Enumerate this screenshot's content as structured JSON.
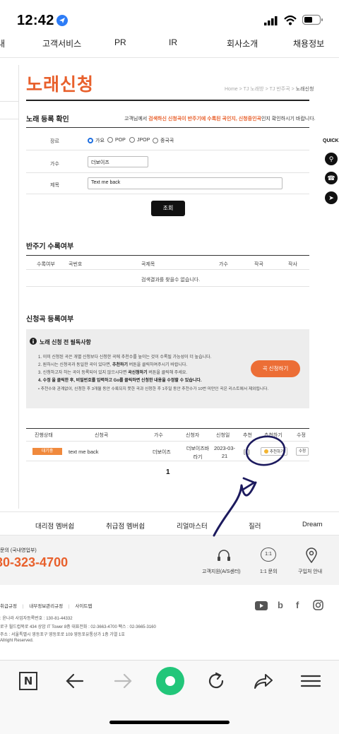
{
  "status_bar": {
    "time": "12:42"
  },
  "nav": {
    "items": [
      "내",
      "고객서비스",
      "PR",
      "IR",
      "회사소개",
      "채용정보"
    ]
  },
  "page": {
    "title": "노래신청",
    "breadcrumb": [
      "Home",
      ">",
      "TJ 노래방",
      ">",
      "TJ 반주곡",
      ">"
    ],
    "breadcrumb_current": "노래신청"
  },
  "register": {
    "heading": "노래 등록 확인",
    "notice_prefix": "고객님께서 ",
    "notice_highlight": "검색하신 신청곡이 반주기에 수록된 곡인지, 신청중인곡",
    "notice_suffix": "인지 확인하시기 바랍니다.",
    "genre_label": "장르",
    "genre_options": [
      "가요",
      "POP",
      "JPOP",
      "중국곡"
    ],
    "genre_selected": "가요",
    "singer_label": "가수",
    "singer_value": "더보이즈",
    "title_label": "제목",
    "title_value": "Text me back",
    "search_button": "조회"
  },
  "accompaniment": {
    "heading": "반주기 수록여부",
    "columns": [
      "수록여부",
      "곡번호",
      "곡제목",
      "가수",
      "작곡",
      "작사"
    ],
    "empty_message": "검색결과를 찾을수 없습니다."
  },
  "applied": {
    "heading": "신청곡 등록여부",
    "guide_title": "노래 신청 전 필독사항",
    "guide_lines": [
      "1. 이미 신청된 곡은 개별 신청보다 신청한 곡에 추천수를 높이는 것이 수록될 가능성이 더 높습니다.",
      "2. 원하시는 신청곡과 동일한 곡이 있다면, ",
      "3. 신청하고자 하는 곡이 등록되어 있지 않으시다면 ",
      "4. 수정 을 클릭한 후, 비밀번호를 입력하고 Go를 클릭하면 신청한 내용을 수정할 수 있습니다.",
      "• 추천수와 관계없이, 신청한 후 3개월 동안 수록되지 못한 곡과 신청한 후 1주일 동안 추천수가 10번 미만인 곡은 리스트에서 제외됩니다."
    ],
    "guide_bold_1": "추천하기",
    "guide_tail_1": " 버튼을 클릭하여주시기 바랍니다.",
    "guide_bold_2": "곡신청하기",
    "guide_tail_2": " 버튼을 클릭해 주세요.",
    "apply_button": "곡 신청하기",
    "columns": [
      "진행상태",
      "신청곡",
      "가수",
      "신청자",
      "신청일",
      "추천",
      "추천하기",
      "수정"
    ],
    "rows": [
      {
        "status": "대기중",
        "song": "text me back",
        "singer": "더보이즈",
        "applicant_line1": "더보이즈바",
        "applicant_line2": "라기",
        "date_line1": "2023-03-",
        "date_line2": "21",
        "recommend_count": "[1]",
        "recommend_button": "추천하기",
        "edit_button": "수정"
      }
    ],
    "pagination": "1"
  },
  "quick": {
    "label": "QUICK"
  },
  "membership": {
    "items": [
      "대리점 멤버쉽",
      "취급점 멤버쉽",
      "리얼마스터",
      "질러",
      "Dream"
    ]
  },
  "contact": {
    "label": "문의 (국내영업부)",
    "phone": "30-323-4700",
    "items": [
      "고객지원(A/S센터)",
      "1:1 문의",
      "구입처 안내"
    ],
    "chat_icon_text": "1:1"
  },
  "footer": {
    "links": [
      "취급규정",
      "|",
      "내부정보관리규정",
      "|",
      "사이트맵"
    ],
    "info": [
      ": 윤나라    사업자등록번호 : 130-81-44332",
      "로구 월드컵북로 434 상암 IT Tower 8층    대표전화 : 02-3663-4700    팩스 : 02-3665-3160",
      "주소 : 서울특별시 영등포구 영등포로 109 영등포유통상가 1층 가열 1호",
      "Allright Reserved."
    ],
    "social": [
      "youtube-icon",
      "blog-icon",
      "facebook-icon",
      "instagram-icon"
    ]
  },
  "colors": {
    "accent": "#e8602c",
    "apply_button": "#ec6e36",
    "radio_selected": "#1f6fe0",
    "annotation": "#1c1a5e"
  }
}
